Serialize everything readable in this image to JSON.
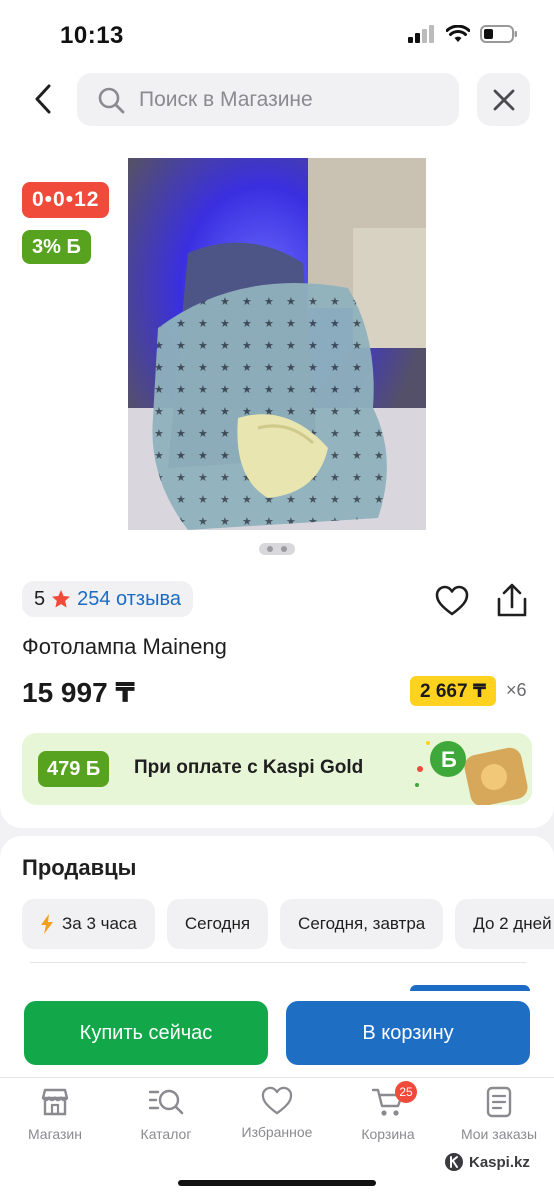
{
  "status_bar": {
    "time": "10:13"
  },
  "search": {
    "placeholder": "Поиск в Магазине"
  },
  "product": {
    "promo_badge": "0•0•12",
    "bonus_badge": "3% Б",
    "rating": "5",
    "reviews": "254 отзыва",
    "title": "Фотолампа Maineng",
    "price": "15 997 ₸",
    "installment_price": "2 667 ₸",
    "installment_months": "×6",
    "carousel": {
      "count": 2,
      "active": 1
    }
  },
  "gold_banner": {
    "bonus": "479 Б",
    "text": "При оплате с Kaspi Gold"
  },
  "sellers": {
    "title": "Продавцы",
    "chips": [
      {
        "label": "За 3 часа",
        "icon": "lightning-icon"
      },
      {
        "label": "Сегодня"
      },
      {
        "label": "Сегодня, завтра"
      },
      {
        "label": "До 2 дней"
      }
    ]
  },
  "actions": {
    "buy_label": "Купить сейчас",
    "cart_label": "В корзину"
  },
  "tabbar": {
    "items": [
      {
        "label": "Магазин",
        "icon": "store-icon"
      },
      {
        "label": "Каталог",
        "icon": "catalog-search-icon"
      },
      {
        "label": "Избранное",
        "icon": "heart-icon"
      },
      {
        "label": "Корзина",
        "icon": "cart-icon",
        "badge": "25"
      },
      {
        "label": "Мои заказы",
        "icon": "orders-icon"
      }
    ]
  },
  "watermark": "Kaspi.kz",
  "colors": {
    "promo_red": "#f04a3a",
    "bonus_green": "#57a21e",
    "buy_green": "#12a84a",
    "cart_blue": "#1e6fc4",
    "installment_yellow": "#ffd21f",
    "link_blue": "#1c6cc6"
  }
}
